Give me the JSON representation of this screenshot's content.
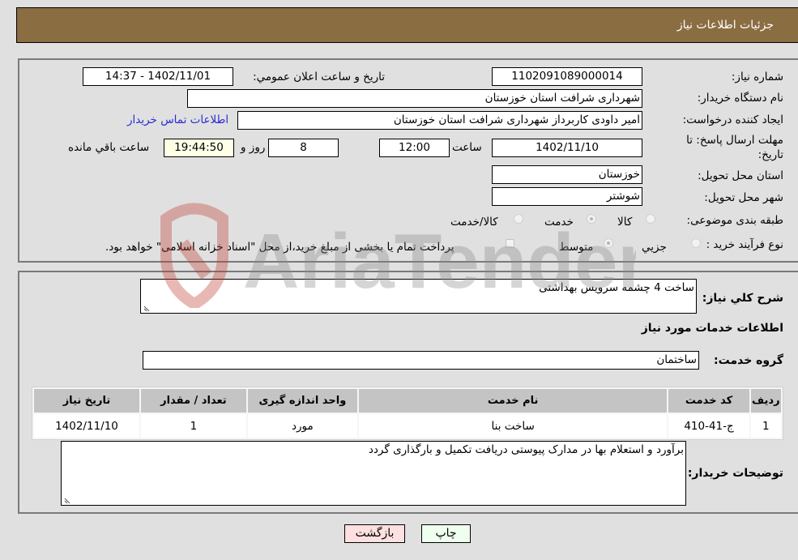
{
  "header": {
    "title": "جزئیات اطلاعات نیاز"
  },
  "form": {
    "need_number": {
      "label": "شماره نیاز:",
      "value": "1102091089000014"
    },
    "announce_datetime": {
      "label": "تاریخ و ساعت اعلان عمومي:",
      "value": "1402/11/01 - 14:37"
    },
    "buyer_org": {
      "label": "نام دستگاه خریدار:",
      "value": "شهرداری شرافت استان خوزستان"
    },
    "requester": {
      "label": "ایجاد کننده درخواست:",
      "value": "امیر داودی کاربرداز شهرداری شرافت استان خوزستان"
    },
    "buyer_contact_link": "اطلاعات تماس خریدار",
    "deadline": {
      "label": "مهلت ارسال پاسخ: تا تاریخ:",
      "date": "1402/11/10",
      "time_label": "ساعت",
      "time": "12:00",
      "days": "8",
      "days_label": "روز و",
      "remaining": "19:44:50",
      "remaining_label": "ساعت باقي مانده"
    },
    "delivery_province": {
      "label": "استان محل تحویل:",
      "value": "خوزستان"
    },
    "delivery_city": {
      "label": "شهر محل تحویل:",
      "value": "شوشتر"
    },
    "category": {
      "label": "طبقه بندی موضوعی:",
      "options": [
        "کالا",
        "خدمت",
        "کالا/خدمت"
      ],
      "selected": "خدمت"
    },
    "purchase_process": {
      "label": "نوع فرآیند خرید :",
      "options": [
        "جزيي",
        "متوسط"
      ],
      "selected": "متوسط",
      "treasury_note": "پرداخت تمام یا بخشی از مبلغ خرید،از محل \"اسناد خزانه اسلامی\" خواهد بود."
    }
  },
  "details": {
    "summary_label": "شرح کلي نیاز:",
    "summary_value": "ساخت 4 چشمه سرویس بهداشتی",
    "services_heading": "اطلاعات خدمات مورد نیاز",
    "service_group_label": "گروه خدمت:",
    "service_group_value": "ساختمان",
    "table": {
      "headers": [
        "ردیف",
        "کد خدمت",
        "نام خدمت",
        "واحد اندازه گیری",
        "تعداد / مقدار",
        "تاریخ نیاز"
      ],
      "rows": [
        [
          "1",
          "ج-41-410",
          "ساخت بنا",
          "مورد",
          "1",
          "1402/11/10"
        ]
      ]
    },
    "buyer_notes_label": "توضیحات خریدار:",
    "buyer_notes_value": "برآورد و استعلام بها در مدارک پیوستی دریافت تکمیل و بارگذاری گردد"
  },
  "buttons": {
    "print": "چاپ",
    "back": "بازگشت"
  },
  "watermark": {
    "text": "AriaTender.neT"
  }
}
